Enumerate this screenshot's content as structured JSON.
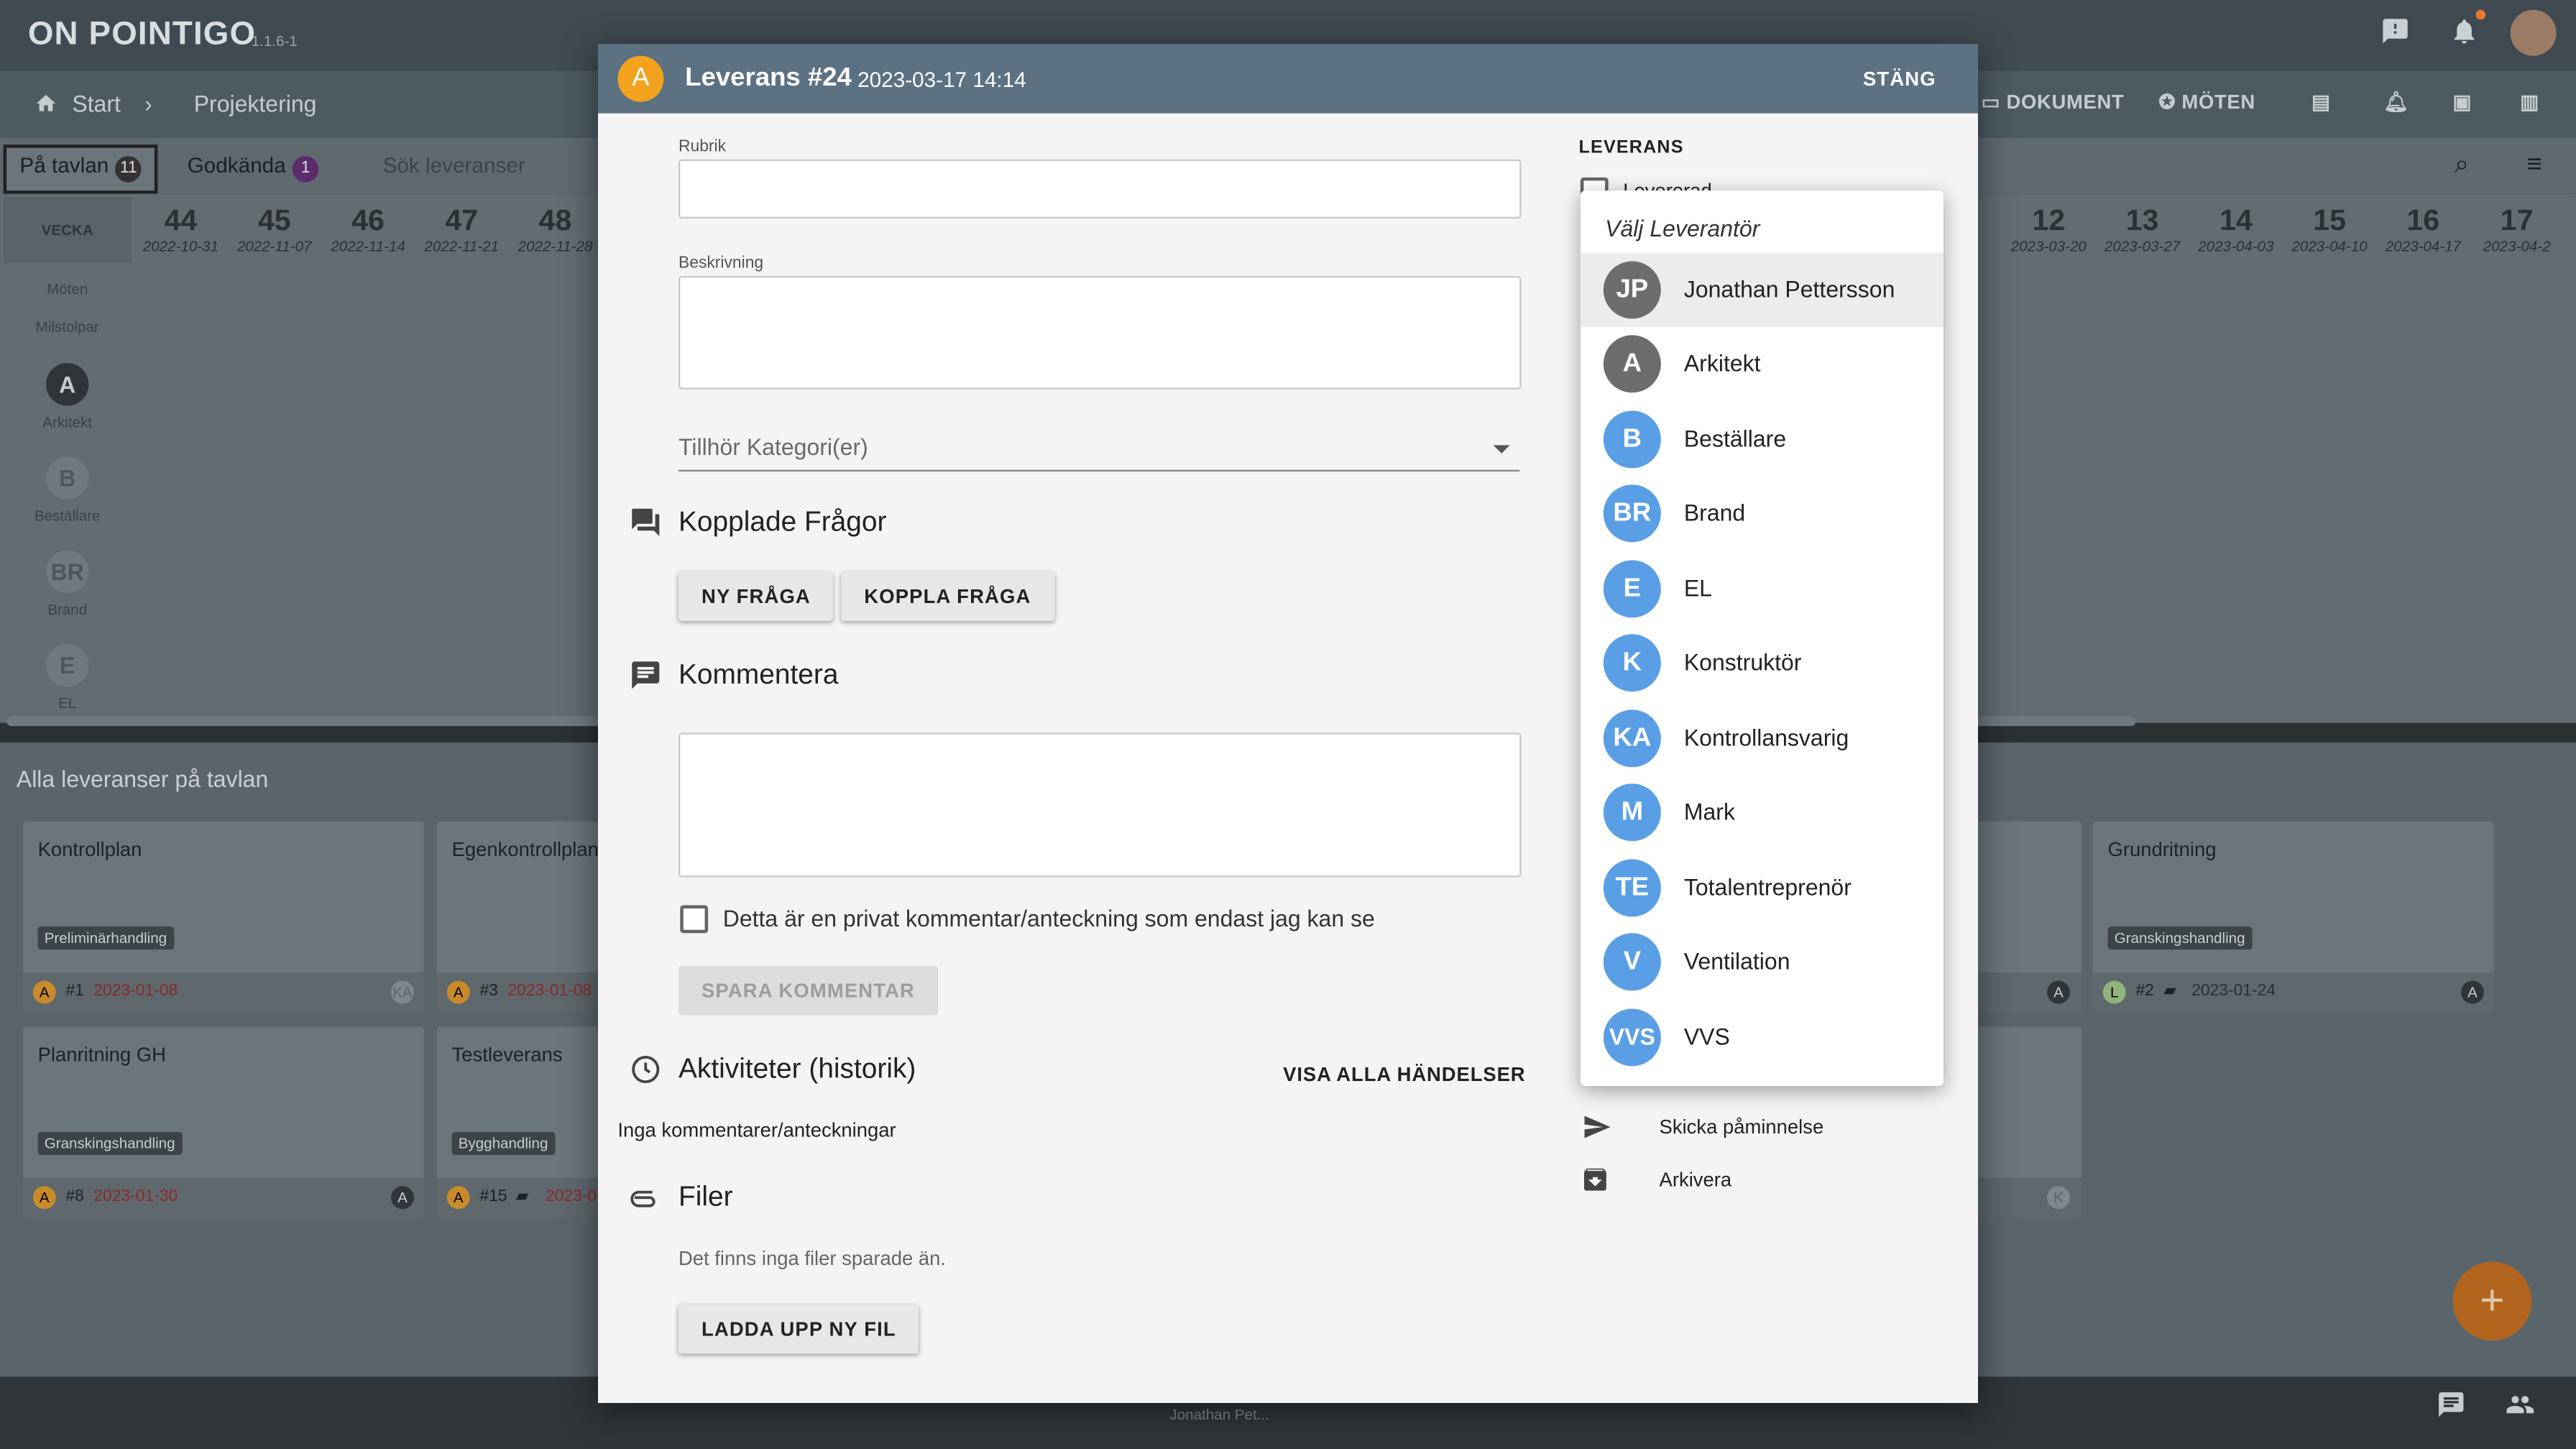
{
  "app": {
    "name": "ON POINTIGO",
    "version": "1.1.6-1"
  },
  "nav": {
    "start": "Start",
    "project": "Projektering",
    "documents": "DOKUMENT",
    "meetings": "MÖTEN"
  },
  "tabs": [
    {
      "label": "På tavlan",
      "count": "11"
    },
    {
      "label": "Godkända",
      "count": "1"
    },
    {
      "label": "Sök leveranser",
      "count": ""
    }
  ],
  "weeks": {
    "label": "VECKA",
    "left": [
      {
        "n": "44",
        "d": "2022-10-31"
      },
      {
        "n": "45",
        "d": "2022-11-07"
      },
      {
        "n": "46",
        "d": "2022-11-14"
      },
      {
        "n": "47",
        "d": "2022-11-21"
      },
      {
        "n": "48",
        "d": "2022-11-28"
      }
    ],
    "right": [
      {
        "n": "12",
        "d": "2023-03-20"
      },
      {
        "n": "13",
        "d": "2023-03-27"
      },
      {
        "n": "14",
        "d": "2023-04-03"
      },
      {
        "n": "15",
        "d": "2023-04-10"
      },
      {
        "n": "16",
        "d": "2023-04-17"
      },
      {
        "n": "17",
        "d": "2023-04-2"
      }
    ]
  },
  "rows": {
    "meetings": "Möten",
    "milestones": "Milstolpar",
    "suppliers": [
      {
        "initials": "A",
        "name": "Arkitekt"
      },
      {
        "initials": "B",
        "name": "Beställare"
      },
      {
        "initials": "BR",
        "name": "Brand"
      },
      {
        "initials": "E",
        "name": "EL"
      }
    ]
  },
  "board": {
    "title": "Alla leveranser på tavlan",
    "cards": [
      {
        "title": "Kontrollplan",
        "tag": "Preliminärhandling",
        "avatar": "A",
        "num": "#1",
        "date": "2023-01-08",
        "right": "KA"
      },
      {
        "title": "Egenkontrollplan",
        "tag": "",
        "avatar": "A",
        "num": "#3",
        "date": "2023-01-08",
        "right": ""
      },
      {
        "title": "Grundritning",
        "tag": "Granskingshandling",
        "avatar": "L",
        "num": "#2",
        "date": "2023-01-24",
        "right": "A"
      },
      {
        "title": "Planritning GH",
        "tag": "Granskingshandling",
        "avatar": "A",
        "num": "#8",
        "date": "2023-01-30",
        "right": "A"
      },
      {
        "title": "Testleverans",
        "tag": "Bygghandling",
        "avatar": "A",
        "num": "#15",
        "date": "2023-0",
        "right": ""
      }
    ]
  },
  "footer": {
    "user": "Jonathan Pet..."
  },
  "modal": {
    "avatar": "A",
    "title": "Leverans #24",
    "date": "2023-03-17 14:14",
    "close": "STÄNG",
    "rubrik_label": "Rubrik",
    "beskrivning_label": "Beskrivning",
    "category_placeholder": "Tillhör Kategori(er)",
    "questions": {
      "title": "Kopplade Frågor",
      "new": "NY FRÅGA",
      "link": "KOPPLA FRÅGA"
    },
    "comment": {
      "title": "Kommentera",
      "private_label": "Detta är en privat kommentar/anteckning som endast jag kan se",
      "save": "SPARA KOMMENTAR"
    },
    "activity": {
      "title": "Aktiviteter (historik)",
      "show_all": "VISA ALLA HÄNDELSER",
      "empty": "Inga kommentarer/anteckningar"
    },
    "files": {
      "title": "Filer",
      "empty": "Det finns inga filer sparade än.",
      "upload": "LADDA UPP NY FIL"
    },
    "side": {
      "heading": "LEVERANS",
      "delivered": "Levererad",
      "remind": "Skicka påminnelse",
      "archive": "Arkivera"
    }
  },
  "dropdown": {
    "title": "Välj Leverantör",
    "colors": {
      "dark": "#6d6d6d",
      "blue": "#5a9fe6"
    },
    "items": [
      {
        "initials": "JP",
        "name": "Jonathan Pettersson",
        "selected": true
      },
      {
        "initials": "A",
        "name": "Arkitekt"
      },
      {
        "initials": "B",
        "name": "Beställare"
      },
      {
        "initials": "BR",
        "name": "Brand"
      },
      {
        "initials": "E",
        "name": "EL"
      },
      {
        "initials": "K",
        "name": "Konstruktör"
      },
      {
        "initials": "KA",
        "name": "Kontrollansvarig"
      },
      {
        "initials": "M",
        "name": "Mark"
      },
      {
        "initials": "TE",
        "name": "Totalentreprenör"
      },
      {
        "initials": "V",
        "name": "Ventilation"
      },
      {
        "initials": "VVS",
        "name": "VVS"
      }
    ]
  }
}
